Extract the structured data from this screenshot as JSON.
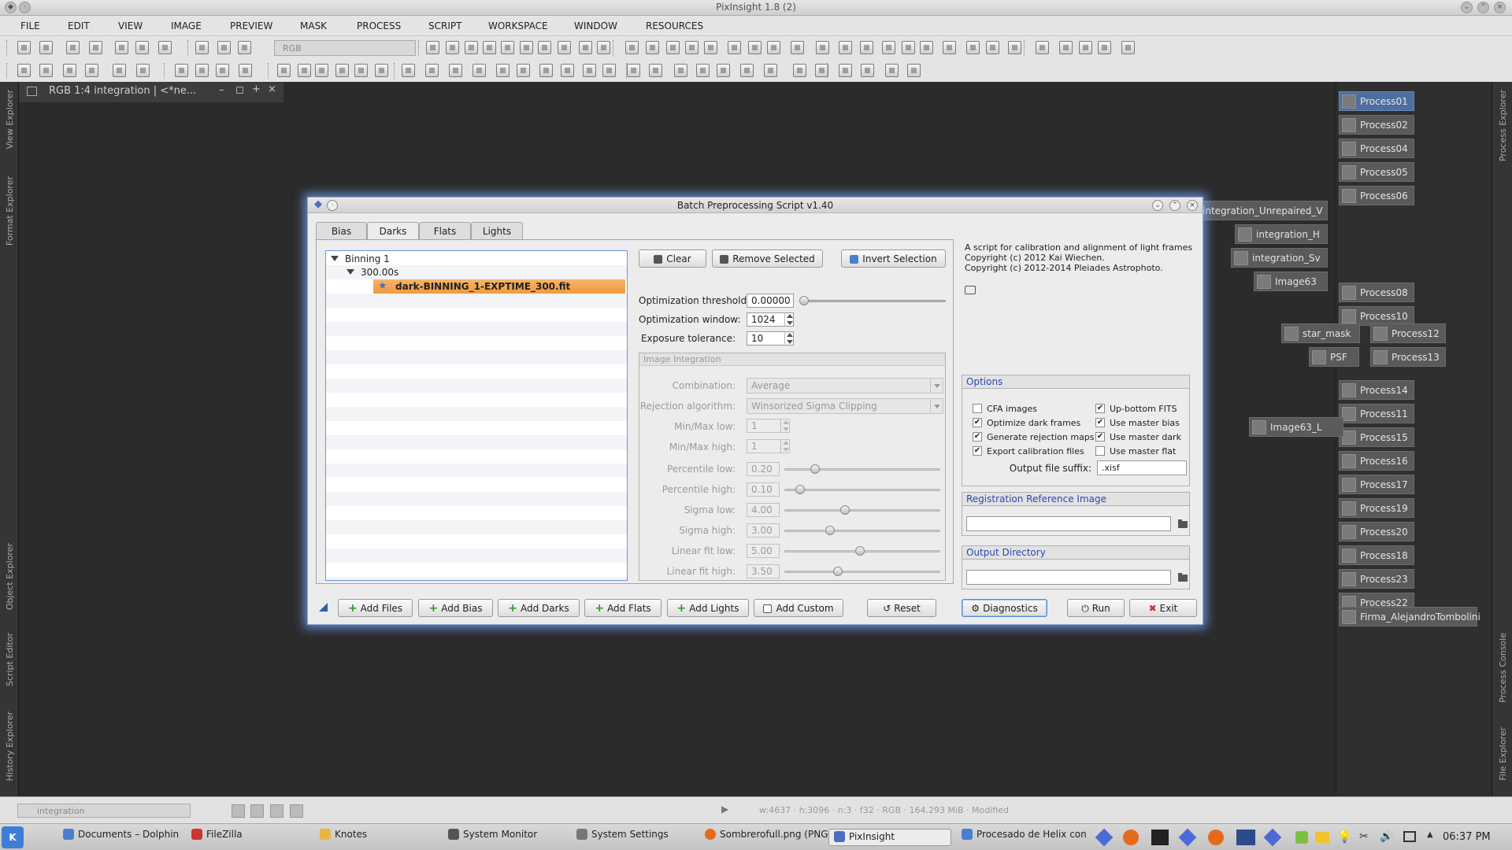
{
  "app": {
    "title": "PixInsight 1.8 (2)"
  },
  "menu": [
    "FILE",
    "EDIT",
    "VIEW",
    "IMAGE",
    "PREVIEW",
    "MASK",
    "PROCESS",
    "SCRIPT",
    "WORKSPACE",
    "WINDOW",
    "RESOURCES"
  ],
  "toolbar": {
    "rgb_label": "RGB"
  },
  "docks": {
    "left": [
      "View Explorer",
      "Format Explorer",
      "Object Explorer",
      "Script Editor",
      "History Explorer"
    ],
    "right": [
      "Process Explorer",
      "Process Console",
      "File Explorer"
    ]
  },
  "image_window": {
    "title": "RGB 1:4 integration | <*ne..."
  },
  "process_icons": [
    "Process01",
    "Process02",
    "Process04",
    "Process05",
    "Process06",
    "Process08",
    "Process10",
    "Process12",
    "Process13",
    "Process14",
    "Process11",
    "Process15",
    "Process16",
    "Process17",
    "Process19",
    "Process20",
    "Process18",
    "Process23",
    "Process22",
    "Firma_AlejandroTombolini"
  ],
  "image_icons": [
    "integration_Unrepaired_V",
    "integration_H",
    "integration_Sv",
    "Image63",
    "star_mask",
    "PSF",
    "Image63_L"
  ],
  "dialog": {
    "title": "Batch Preprocessing Script v1.40",
    "tabs": [
      "Bias",
      "Darks",
      "Flats",
      "Lights"
    ],
    "tree": {
      "group": "Binning 1",
      "exposure": "300.00s",
      "file": "dark-BINNING_1-EXPTIME_300.fit"
    },
    "buttons": {
      "clear": "Clear",
      "remove_selected": "Remove Selected",
      "invert_selection": "Invert Selection"
    },
    "optimization_threshold": {
      "label": "Optimization threshold:",
      "value": "0.00000",
      "level": 0.0
    },
    "optimization_window": {
      "label": "Optimization window:",
      "value": "1024"
    },
    "exposure_tolerance": {
      "label": "Exposure tolerance:",
      "value": "10"
    },
    "integration": {
      "title": "Image Integration",
      "combination": {
        "label": "Combination:",
        "value": "Average"
      },
      "rejection": {
        "label": "Rejection algorithm:",
        "value": "Winsorized Sigma Clipping"
      },
      "minmax_low": {
        "label": "Min/Max low:",
        "value": "1"
      },
      "minmax_high": {
        "label": "Min/Max high:",
        "value": "1"
      },
      "sliders": [
        {
          "label": "Percentile low:",
          "value": "0.20",
          "level": 0.2
        },
        {
          "label": "Percentile high:",
          "value": "0.10",
          "level": 0.1
        },
        {
          "label": "Sigma low:",
          "value": "4.00",
          "level": 0.4
        },
        {
          "label": "Sigma high:",
          "value": "3.00",
          "level": 0.3
        },
        {
          "label": "Linear fit low:",
          "value": "5.00",
          "level": 0.5
        },
        {
          "label": "Linear fit high:",
          "value": "3.50",
          "level": 0.35
        }
      ]
    },
    "about": [
      "A script for calibration and alignment of light frames",
      "Copyright (c) 2012 Kai Wiechen.",
      "Copyright (c) 2012-2014 Pleiades Astrophoto."
    ],
    "options": {
      "title": "Options",
      "left": [
        {
          "label": "CFA images",
          "checked": false
        },
        {
          "label": "Optimize dark frames",
          "checked": true
        },
        {
          "label": "Generate rejection maps",
          "checked": true
        },
        {
          "label": "Export calibration files",
          "checked": true
        }
      ],
      "right": [
        {
          "label": "Up-bottom FITS",
          "checked": true
        },
        {
          "label": "Use master bias",
          "checked": true
        },
        {
          "label": "Use master dark",
          "checked": true
        },
        {
          "label": "Use master flat",
          "checked": false
        }
      ],
      "suffix_label": "Output file suffix:",
      "suffix_value": ".xisf"
    },
    "registration": {
      "title": "Registration Reference Image",
      "value": ""
    },
    "output": {
      "title": "Output Directory",
      "value": ""
    },
    "bottom": {
      "add_files": "Add Files",
      "add_bias": "Add Bias",
      "add_darks": "Add Darks",
      "add_flats": "Add Flats",
      "add_lights": "Add Lights",
      "add_custom": "Add Custom",
      "reset": "Reset",
      "diagnostics": "Diagnostics",
      "run": "Run",
      "exit": "Exit"
    }
  },
  "status": {
    "view": "integration",
    "info": "w:4637  ·  h:3096  ·  n:3  ·  f32  ·  RGB  ·  164.293 MiB  ·  Modified"
  },
  "taskbar": {
    "items": [
      "Documents – Dolphin",
      "FileZilla",
      "Knotes",
      "System Monitor",
      "System Settings",
      "Sombrerofull.png (PNG",
      "PixInsight",
      "Procesado de Helix con"
    ],
    "clock": "06:37 PM"
  },
  "colors": {
    "selection": "#f4a85a",
    "dialog_glow": "#78aaff",
    "section_title": "#2948b3"
  }
}
